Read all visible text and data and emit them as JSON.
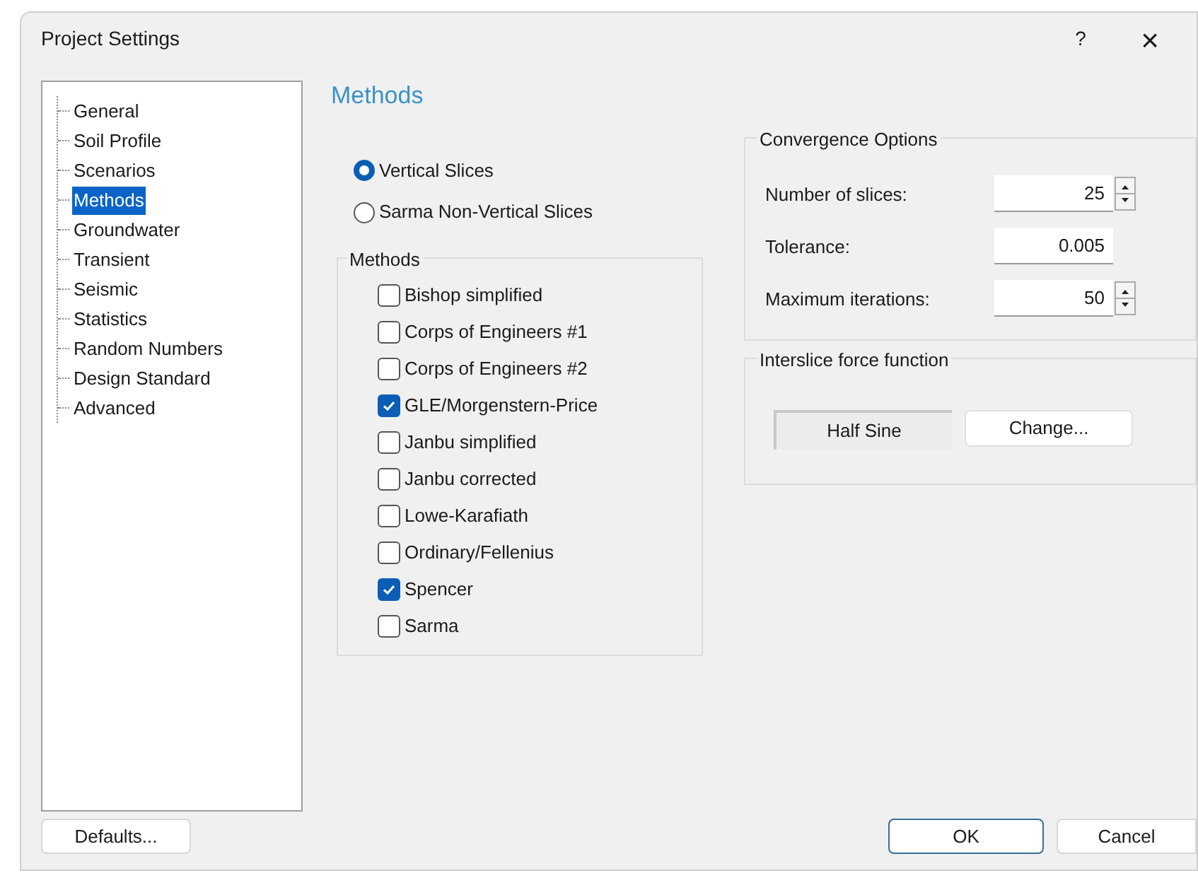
{
  "window": {
    "title": "Project Settings",
    "help": "?",
    "close": "×"
  },
  "tree": [
    {
      "label": "General",
      "selected": false
    },
    {
      "label": "Soil Profile",
      "selected": false
    },
    {
      "label": "Scenarios",
      "selected": false
    },
    {
      "label": "Methods",
      "selected": true
    },
    {
      "label": "Groundwater",
      "selected": false
    },
    {
      "label": "Transient",
      "selected": false
    },
    {
      "label": "Seismic",
      "selected": false
    },
    {
      "label": "Statistics",
      "selected": false
    },
    {
      "label": "Random Numbers",
      "selected": false
    },
    {
      "label": "Design Standard",
      "selected": false
    },
    {
      "label": "Advanced",
      "selected": false
    }
  ],
  "heading": "Methods",
  "slice_options": [
    {
      "label": "Vertical Slices",
      "selected": true
    },
    {
      "label": "Sarma Non-Vertical Slices",
      "selected": false
    }
  ],
  "methods_group": {
    "title": "Methods",
    "items": [
      {
        "label": "Bishop simplified",
        "checked": false
      },
      {
        "label": "Corps of Engineers #1",
        "checked": false
      },
      {
        "label": "Corps of Engineers #2",
        "checked": false
      },
      {
        "label": "GLE/Morgenstern-Price",
        "checked": true
      },
      {
        "label": "Janbu simplified",
        "checked": false
      },
      {
        "label": "Janbu corrected",
        "checked": false
      },
      {
        "label": "Lowe-Karafiath",
        "checked": false
      },
      {
        "label": "Ordinary/Fellenius",
        "checked": false
      },
      {
        "label": "Spencer",
        "checked": true
      },
      {
        "label": "Sarma",
        "checked": false
      }
    ]
  },
  "convergence": {
    "title": "Convergence Options",
    "fields": [
      {
        "label": "Number of slices:",
        "value": "25",
        "kind": "spinner"
      },
      {
        "label": "Tolerance:",
        "value": "0.005",
        "kind": "text"
      },
      {
        "label": "Maximum iterations:",
        "value": "50",
        "kind": "spinner"
      }
    ]
  },
  "interslice": {
    "title": "Interslice force function",
    "value": "Half Sine",
    "button": "Change..."
  },
  "buttons": {
    "defaults": "Defaults...",
    "ok": "OK",
    "cancel": "Cancel"
  }
}
